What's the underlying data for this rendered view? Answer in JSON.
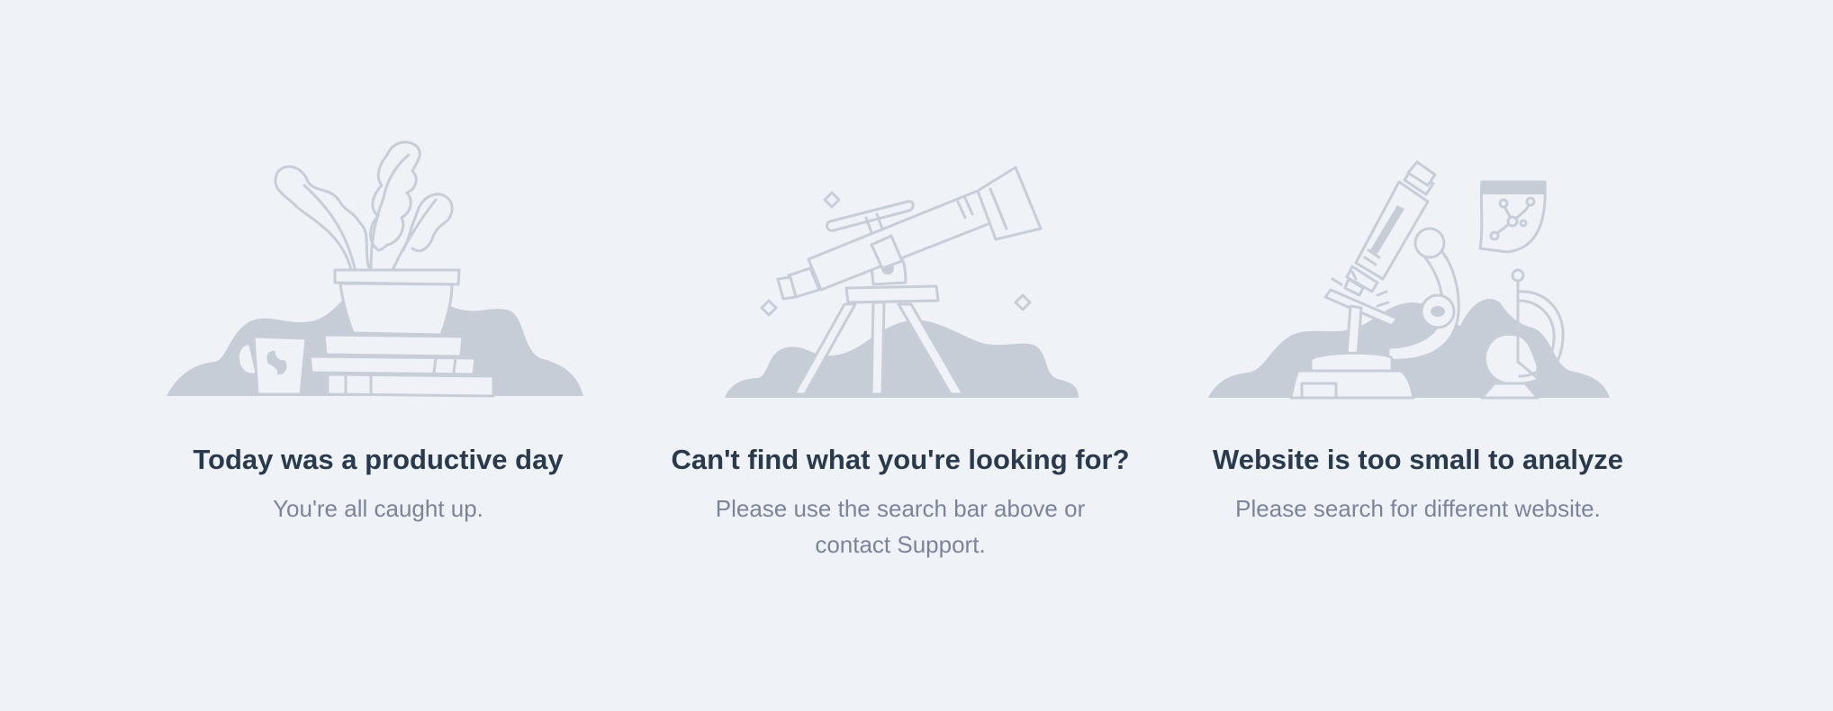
{
  "cards": [
    {
      "title": "Today was a productive day",
      "description": "You're all caught up.",
      "illustration_icon": "plant-books-mug-icon"
    },
    {
      "title": "Can't find what you're looking for?",
      "description": "Please use the search bar above or contact Support.",
      "illustration_icon": "telescope-icon"
    },
    {
      "title": "Website is too small to analyze",
      "description": "Please search for different website.",
      "illustration_icon": "microscope-icon"
    }
  ],
  "colors": {
    "background": "#eff3f7",
    "title": "#2a3a4e",
    "description": "#7c839d",
    "illustration_fill": "#c6cdd6",
    "illustration_stroke": "#c8ced7"
  }
}
